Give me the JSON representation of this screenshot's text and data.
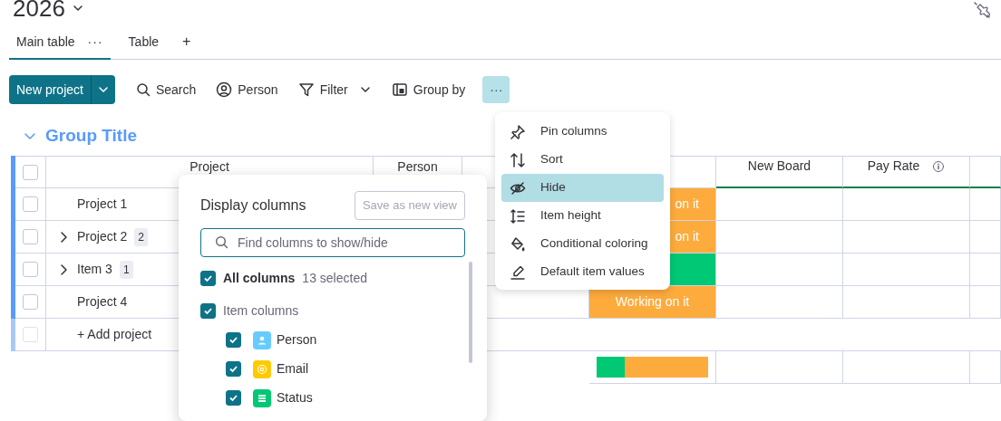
{
  "board": {
    "title": "2026"
  },
  "tabs": [
    {
      "label": "Main table",
      "selected": true,
      "more": "···"
    },
    {
      "label": "Table",
      "selected": false
    }
  ],
  "add_tab": "+",
  "toolbar": {
    "primary": "New project",
    "items": [
      {
        "label": "Search",
        "kind": "search"
      },
      {
        "label": "Person",
        "kind": "person"
      },
      {
        "label": "Filter",
        "kind": "filter",
        "dropdown": true
      },
      {
        "label": "Group by",
        "kind": "group"
      }
    ],
    "more": {
      "label": "···",
      "selected": true
    }
  },
  "group": {
    "title": "Group Title",
    "color": "#579bfc"
  },
  "table": {
    "select_all": {
      "checked": false
    },
    "columns": [
      {
        "kind": "name",
        "label": "Project"
      },
      {
        "kind": "text",
        "label": "Person"
      },
      {
        "kind": "blank"
      },
      {
        "kind": "status"
      },
      {
        "kind": "text",
        "label": "New Board"
      },
      {
        "kind": "text",
        "label": "Pay Rate",
        "info": true
      },
      {
        "kind": "blank"
      }
    ],
    "rows": [
      {
        "name": "Project 1",
        "checked": false,
        "expandable": false,
        "status": {
          "label": "on it",
          "color": "#fdab3d"
        }
      },
      {
        "name": "Project 2",
        "checked": false,
        "expandable": true,
        "subitems": "2",
        "status": {
          "label": "on it",
          "color": "#fdab3d"
        }
      },
      {
        "name": "Item 3",
        "checked": false,
        "expandable": true,
        "subitems": "1",
        "status": {
          "color": "#00c875"
        }
      },
      {
        "name": "Project 4",
        "checked": false,
        "expandable": false,
        "status": {
          "label": "Working on it",
          "color": "#fdab3d"
        }
      }
    ],
    "add_row": {
      "label": "+ Add project",
      "checked": false
    },
    "summary": [
      {
        "color": "#00c875",
        "level": 0.25
      },
      {
        "color": "#fdab3d",
        "level": 0.75
      }
    ]
  },
  "column_menu": {
    "items": [
      {
        "label": "Pin columns",
        "kind": "pin",
        "selected": false
      },
      {
        "label": "Sort",
        "kind": "sort",
        "selected": false
      },
      {
        "label": "Hide",
        "kind": "hide",
        "selected": true
      },
      {
        "label": "Item height",
        "kind": "height",
        "selected": false
      },
      {
        "label": "Conditional coloring",
        "kind": "bucket",
        "selected": false
      },
      {
        "label": "Default item values",
        "kind": "pen",
        "selected": false
      }
    ]
  },
  "display_columns": {
    "title": "Display columns",
    "save_button": {
      "label": "Save as new view",
      "disabled": true
    },
    "search": {
      "placeholder": "Find columns to show/hide"
    },
    "all": {
      "label": "All columns",
      "count": "13 selected",
      "checked": true
    },
    "sections": [
      {
        "label": "Item columns",
        "checked": true,
        "children": [
          {
            "label": "Person",
            "checked": true,
            "kind": "person",
            "color": "#66ccff"
          },
          {
            "label": "Email",
            "checked": true,
            "kind": "email",
            "color": "#ffcb00"
          },
          {
            "label": "Status",
            "checked": true,
            "kind": "status",
            "color": "#00c875"
          }
        ]
      }
    ]
  }
}
